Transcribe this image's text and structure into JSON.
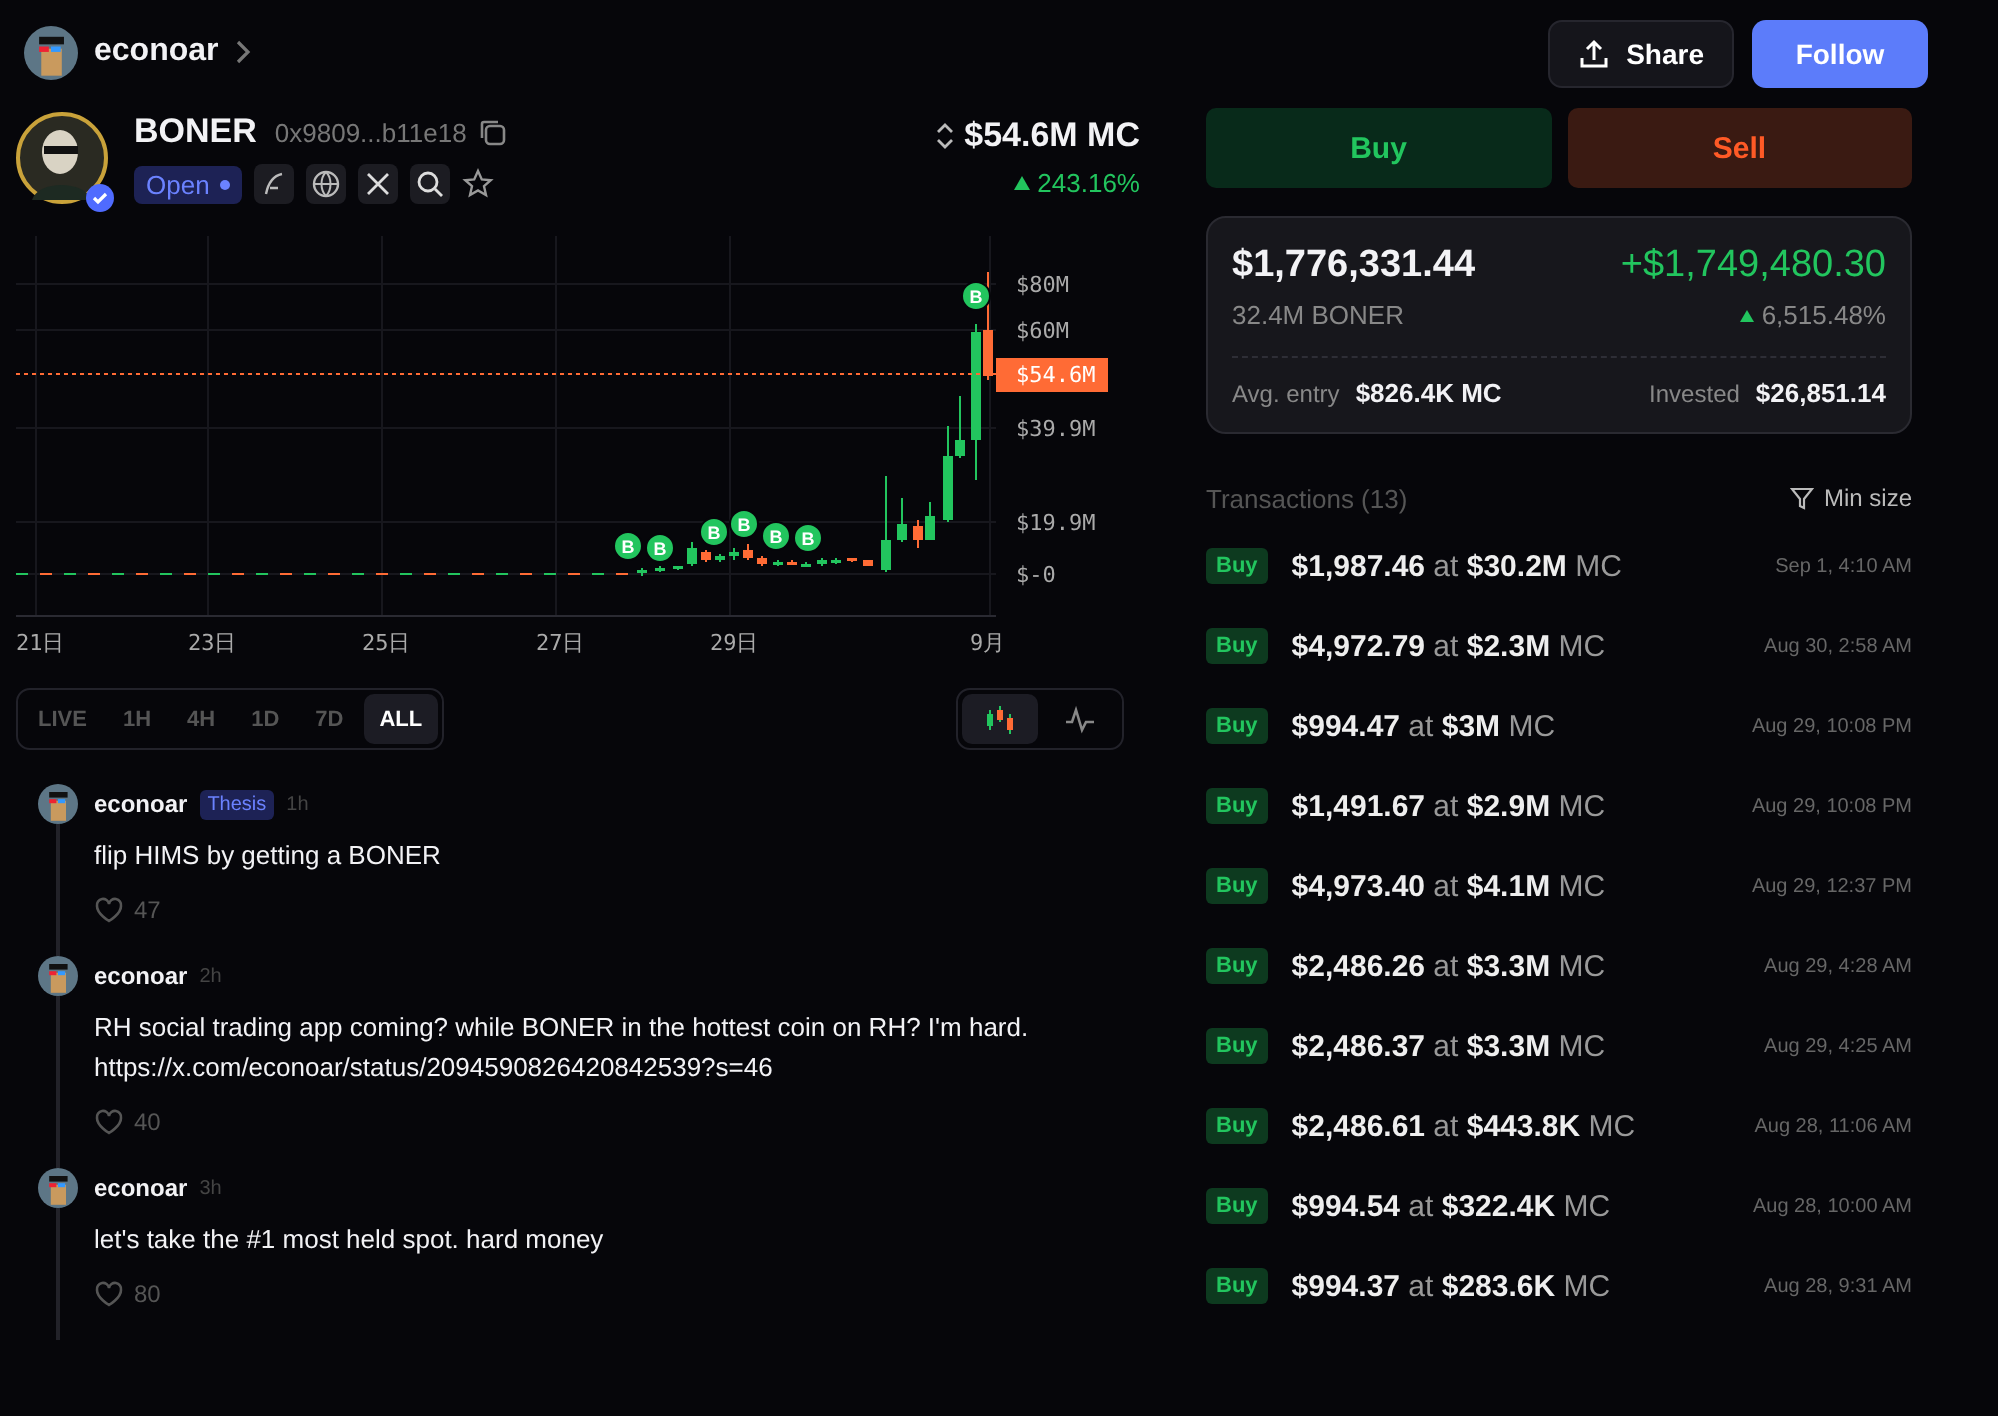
{
  "header": {
    "user": "econoar",
    "share": "Share",
    "follow": "Follow"
  },
  "token": {
    "symbol": "BONER",
    "address": "0x9809...b11e18",
    "status": "Open",
    "verified": true,
    "market_cap": "$54.6M MC",
    "change": "243.16%"
  },
  "chart": {
    "y_ticks": [
      "$80M",
      "$60M",
      "$39.9M",
      "$19.9M",
      "$-0"
    ],
    "x_ticks": [
      "21日",
      "23日",
      "25日",
      "27日",
      "29日",
      "9月"
    ],
    "price_tag": "$54.6M",
    "markers": [
      "B",
      "B",
      "B",
      "B",
      "B",
      "B",
      "B"
    ]
  },
  "timeframes": [
    {
      "label": "LIVE",
      "selected": false
    },
    {
      "label": "1H",
      "selected": false
    },
    {
      "label": "4H",
      "selected": false
    },
    {
      "label": "1D",
      "selected": false
    },
    {
      "label": "7D",
      "selected": false
    },
    {
      "label": "ALL",
      "selected": true
    }
  ],
  "chart_modes": [
    {
      "kind": "candles",
      "selected": true
    },
    {
      "kind": "line",
      "selected": false
    }
  ],
  "comments": [
    {
      "user": "econoar",
      "badge": "Thesis",
      "time": "1h",
      "text": "flip HIMS by getting a BONER",
      "likes": "47"
    },
    {
      "user": "econoar",
      "time": "2h",
      "text": "RH social trading app coming? while BONER in the hottest coin on RH? I'm hard. https://x.com/econoar/status/2094590826420842539?s=46",
      "likes": "40"
    },
    {
      "user": "econoar",
      "time": "3h",
      "text": "let's take the #1 most held spot. hard money",
      "likes": "80"
    }
  ],
  "trade": {
    "buy": "Buy",
    "sell": "Sell"
  },
  "position": {
    "value": "$1,776,331.44",
    "pnl": "+$1,749,480.30",
    "holdings": "32.4M BONER",
    "pnl_percent": "6,515.48%",
    "avg_entry_label": "Avg. entry",
    "avg_entry": "$826.4K MC",
    "invested_label": "Invested",
    "invested": "$26,851.14"
  },
  "transactions": {
    "title": "Transactions (13)",
    "filter": "Min size",
    "rows": [
      {
        "side": "Buy",
        "amount": "$1,987.46",
        "at": "at",
        "market_cap": "$30.2M",
        "unit": "MC",
        "time": "Sep 1, 4:10 AM"
      },
      {
        "side": "Buy",
        "amount": "$4,972.79",
        "at": "at",
        "market_cap": "$2.3M",
        "unit": "MC",
        "time": "Aug 30, 2:58 AM"
      },
      {
        "side": "Buy",
        "amount": "$994.47",
        "at": "at",
        "market_cap": "$3M",
        "unit": "MC",
        "time": "Aug 29, 10:08 PM"
      },
      {
        "side": "Buy",
        "amount": "$1,491.67",
        "at": "at",
        "market_cap": "$2.9M",
        "unit": "MC",
        "time": "Aug 29, 10:08 PM"
      },
      {
        "side": "Buy",
        "amount": "$4,973.40",
        "at": "at",
        "market_cap": "$4.1M",
        "unit": "MC",
        "time": "Aug 29, 12:37 PM"
      },
      {
        "side": "Buy",
        "amount": "$2,486.26",
        "at": "at",
        "market_cap": "$3.3M",
        "unit": "MC",
        "time": "Aug 29, 4:28 AM"
      },
      {
        "side": "Buy",
        "amount": "$2,486.37",
        "at": "at",
        "market_cap": "$3.3M",
        "unit": "MC",
        "time": "Aug 29, 4:25 AM"
      },
      {
        "side": "Buy",
        "amount": "$2,486.61",
        "at": "at",
        "market_cap": "$443.8K",
        "unit": "MC",
        "time": "Aug 28, 11:06 AM"
      },
      {
        "side": "Buy",
        "amount": "$994.54",
        "at": "at",
        "market_cap": "$322.4K",
        "unit": "MC",
        "time": "Aug 28, 10:00 AM"
      },
      {
        "side": "Buy",
        "amount": "$994.37",
        "at": "at",
        "market_cap": "$283.6K",
        "unit": "MC",
        "time": "Aug 28, 9:31 AM"
      }
    ]
  }
}
